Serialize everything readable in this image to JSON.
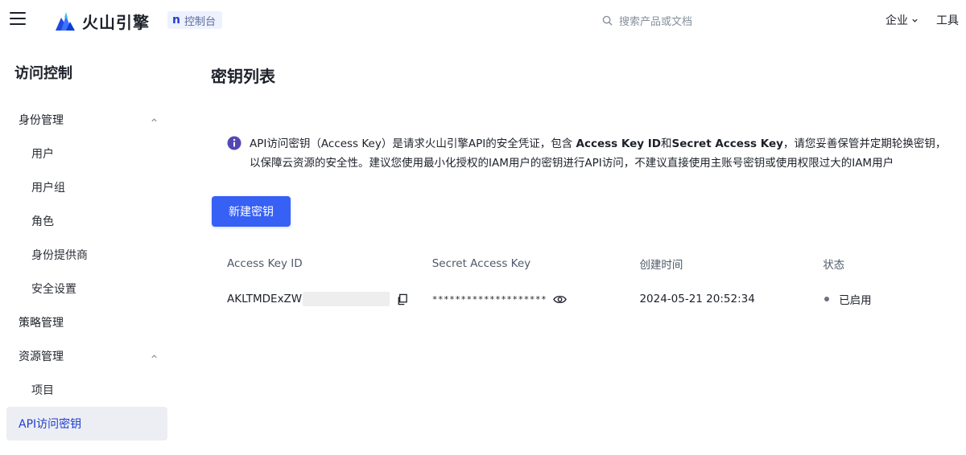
{
  "header": {
    "logo_text": "火山引擎",
    "console_badge": "控制台",
    "search_placeholder": "搜索产品或文档",
    "menu": [
      {
        "label": "企业"
      },
      {
        "label": "工具"
      }
    ]
  },
  "sidebar": {
    "title": "访问控制",
    "items": [
      {
        "label": "身份管理"
      },
      {
        "label": "用户"
      },
      {
        "label": "用户组"
      },
      {
        "label": "角色"
      },
      {
        "label": "身份提供商"
      },
      {
        "label": "安全设置"
      },
      {
        "label": "策略管理"
      },
      {
        "label": "资源管理"
      },
      {
        "label": "项目"
      },
      {
        "label": "API访问密钥"
      }
    ]
  },
  "main": {
    "title": "密钥列表",
    "notice": {
      "p1": "API访问密钥（Access Key）是请求火山引擎API的安全凭证，包含 ",
      "b1": "Access Key ID",
      "p2": "和",
      "b2": "Secret Access Key",
      "p3": "，请您妥善保管并定期轮换密钥，",
      "line2": "以保障云资源的安全性。建议您使用最小化授权的IAM用户的密钥进行API访问，不建议直接使用主账号密钥或使用权限过大的IAM用户"
    },
    "create_button": "新建密钥",
    "table": {
      "columns": [
        "Access Key ID",
        "Secret Access Key",
        "创建时间",
        "状态"
      ],
      "rows": [
        {
          "access_key_id": "AKLTMDExZW",
          "secret": "********************",
          "created": "2024-05-21 20:52:34",
          "status": "已启用"
        }
      ]
    }
  },
  "colors": {
    "primary": "#3760f5",
    "active_bg": "#eceef3",
    "active_text": "#1f3ecb",
    "status_dot": "#6b7280"
  },
  "icons": [
    "menu-icon",
    "volcano-logo",
    "search-icon",
    "chevron-down-icon",
    "chevron-up-icon",
    "info-icon",
    "copy-icon",
    "eye-icon"
  ]
}
